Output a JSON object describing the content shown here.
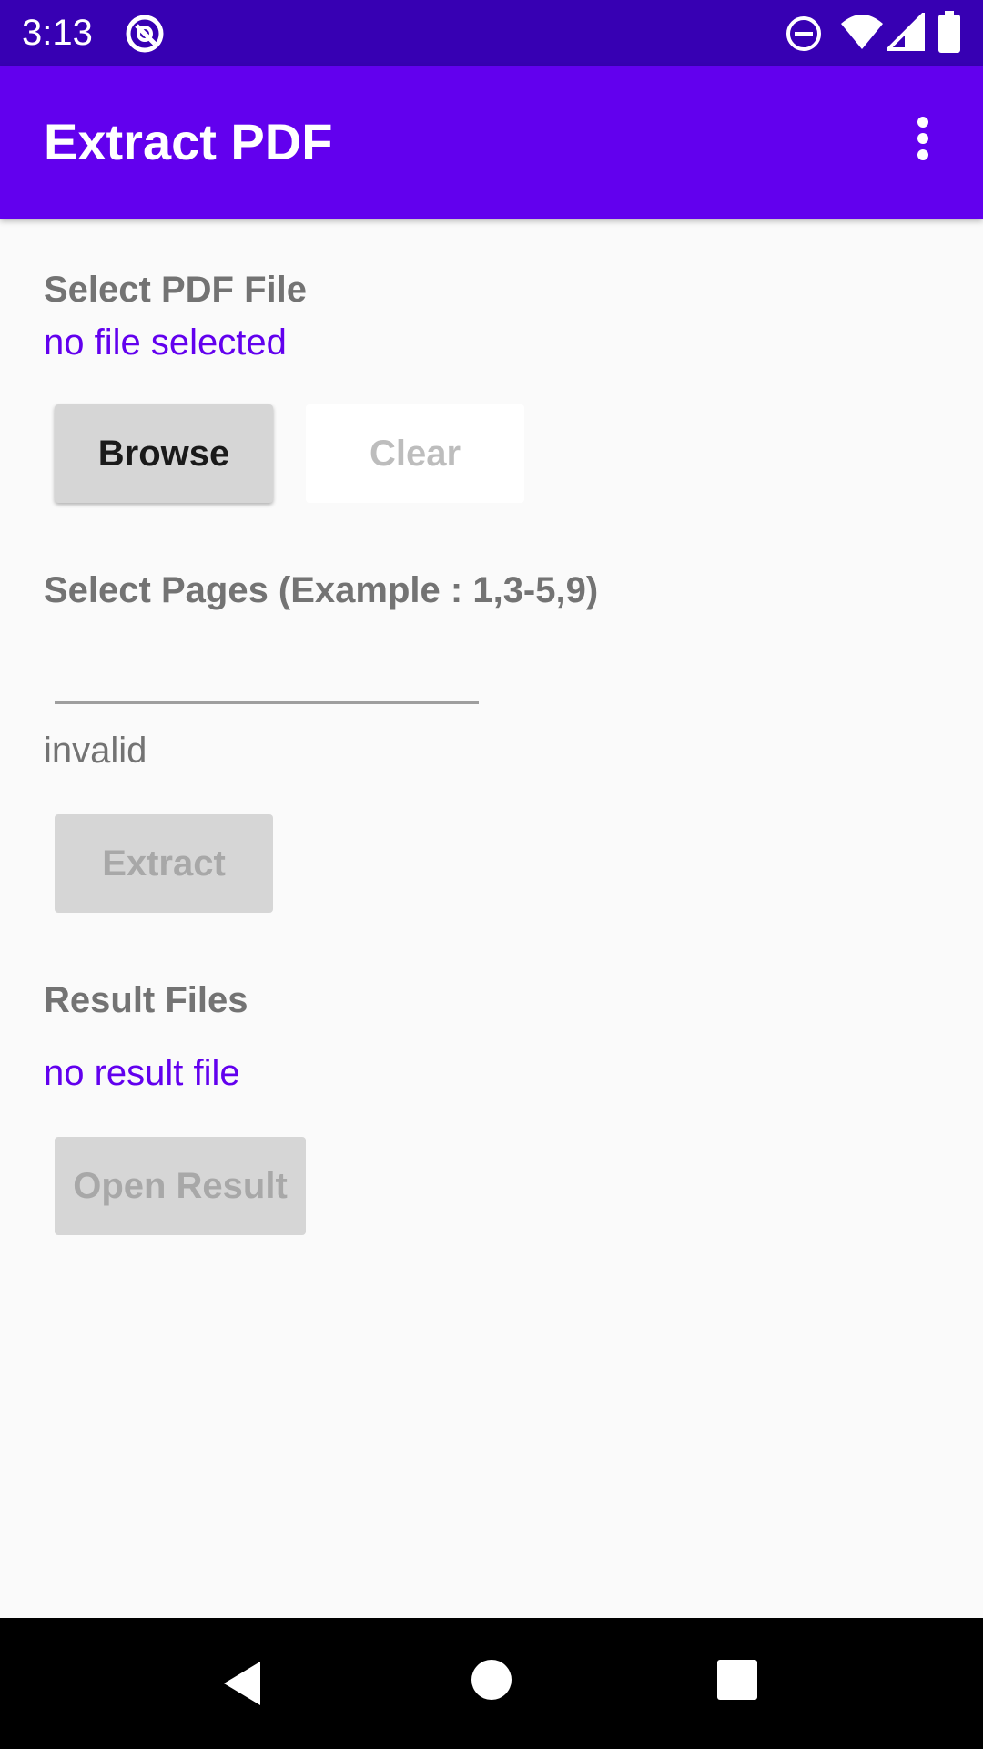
{
  "status_bar": {
    "time": "3:13",
    "icons": [
      "at-sign-icon",
      "do-not-disturb-icon",
      "wifi-icon",
      "signal-icon",
      "battery-icon"
    ]
  },
  "app_bar": {
    "title": "Extract PDF",
    "menu_icon": "more-vert-icon",
    "color": "#6200ee"
  },
  "file_section": {
    "label": "Select PDF File",
    "status": "no file selected",
    "browse_label": "Browse",
    "clear_label": "Clear"
  },
  "pages_section": {
    "label": "Select Pages (Example : 1,3-5,9)",
    "input_value": "",
    "hint": "invalid",
    "extract_label": "Extract"
  },
  "result_section": {
    "label": "Result Files",
    "status": "no result file",
    "open_label": "Open Result"
  },
  "nav_bar": {
    "icons": [
      "back-icon",
      "home-icon",
      "recents-icon"
    ]
  }
}
